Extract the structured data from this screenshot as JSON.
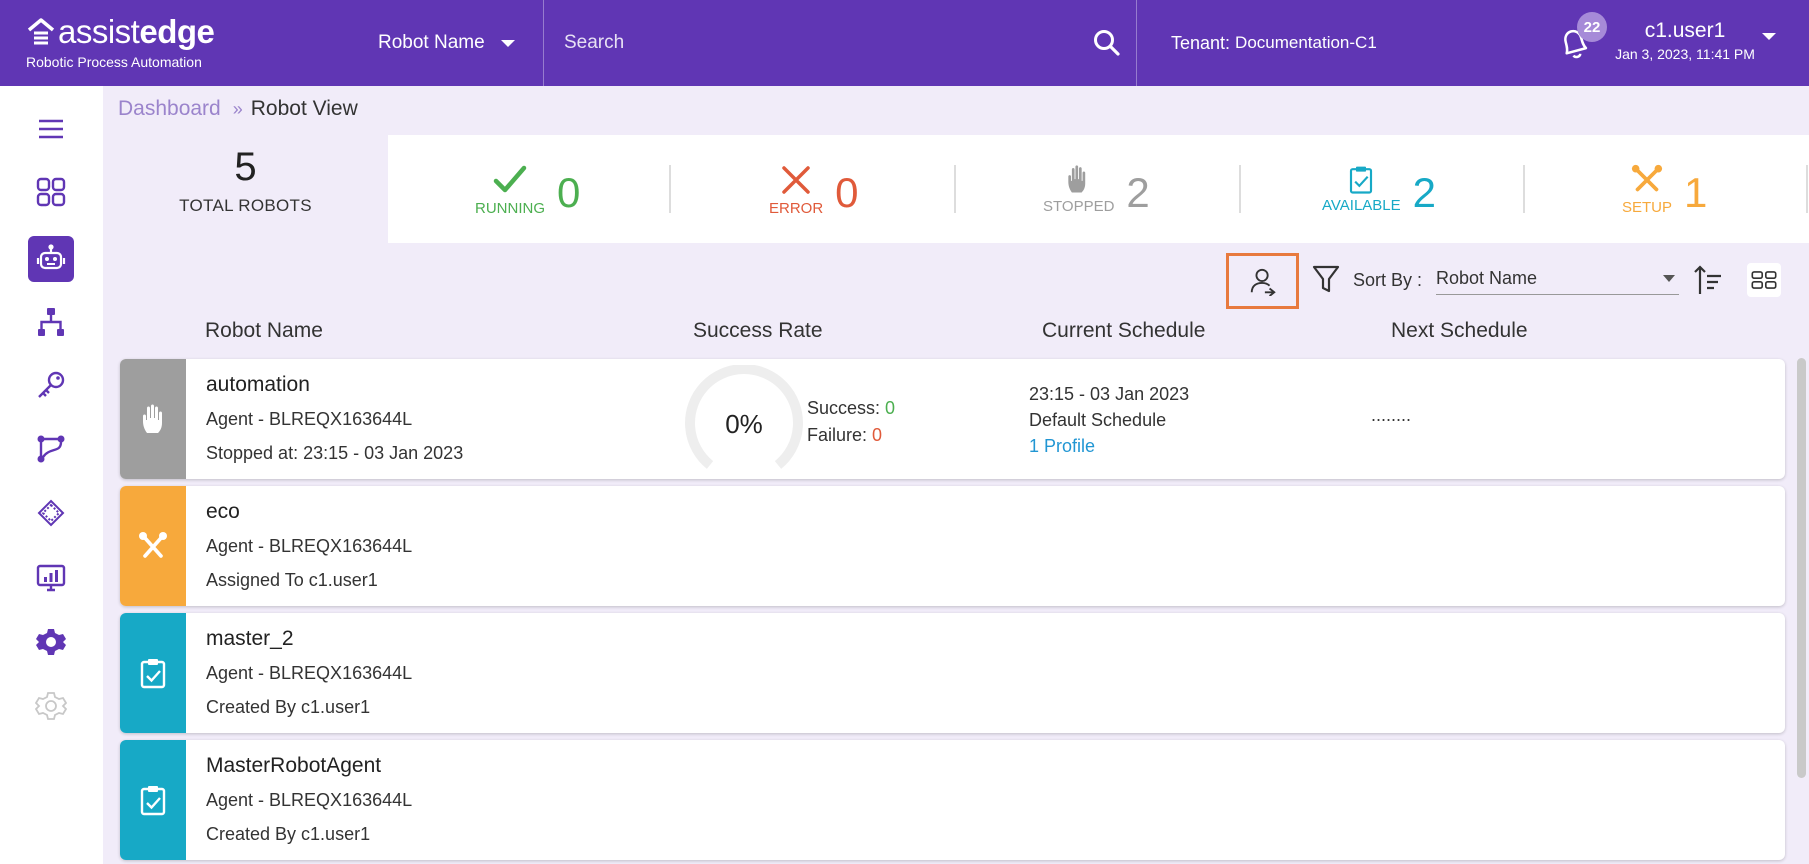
{
  "header": {
    "logo_light": "assist",
    "logo_bold": "edge",
    "logo_sub": "Robotic Process Automation",
    "robot_select_label": "Robot Name",
    "search_placeholder": "Search",
    "tenant_label": "Tenant:",
    "tenant_value": "Documentation-C1",
    "notification_count": "22",
    "user_name": "c1.user1",
    "user_datetime": "Jan 3, 2023, 11:41 PM"
  },
  "colors": {
    "brand": "#6036b4",
    "running": "#4caf50",
    "error": "#e05a3a",
    "stopped": "#9e9e9e",
    "available": "#17a9c6",
    "setup": "#f7a93c",
    "highlight": "#e87a3e"
  },
  "sidebar": {
    "items": [
      {
        "icon": "menu-icon"
      },
      {
        "icon": "dashboard-icon"
      },
      {
        "icon": "robot-icon",
        "active": true
      },
      {
        "icon": "hierarchy-icon"
      },
      {
        "icon": "key-icon"
      },
      {
        "icon": "workflow-icon"
      },
      {
        "icon": "chip-icon"
      },
      {
        "icon": "monitor-chart-icon"
      },
      {
        "icon": "settings-icon"
      },
      {
        "icon": "settings-disabled-icon"
      }
    ]
  },
  "breadcrumb": {
    "parent": "Dashboard",
    "separator": "»",
    "current": "Robot View"
  },
  "stats": {
    "total": {
      "value": "5",
      "label": "TOTAL ROBOTS"
    },
    "running": {
      "label": "RUNNING",
      "value": "0"
    },
    "error": {
      "label": "ERROR",
      "value": "0"
    },
    "stopped": {
      "label": "STOPPED",
      "value": "2"
    },
    "available": {
      "label": "AVAILABLE",
      "value": "2"
    },
    "setup": {
      "label": "SETUP",
      "value": "1"
    }
  },
  "toolbar": {
    "sort_by_label": "Sort By :",
    "sort_value": "Robot Name"
  },
  "columns": {
    "robot_name": "Robot Name",
    "success_rate": "Success Rate",
    "current_schedule": "Current Schedule",
    "next_schedule": "Next Schedule"
  },
  "robots": [
    {
      "name": "automation",
      "agent": "Agent - BLREQX163644L",
      "info": "Stopped at: 23:15 - 03 Jan 2023",
      "status": "stopped",
      "success_rate": "0%",
      "success_label": "Success:",
      "success_count": "0",
      "failure_label": "Failure:",
      "failure_count": "0",
      "schedule_time": "23:15 - 03 Jan 2023",
      "schedule_name": "Default Schedule",
      "schedule_profile": "1 Profile",
      "next_schedule": "........"
    },
    {
      "name": "eco",
      "agent": "Agent - BLREQX163644L",
      "info": "Assigned To c1.user1",
      "status": "setup"
    },
    {
      "name": "master_2",
      "agent": "Agent - BLREQX163644L",
      "info": "Created By c1.user1",
      "status": "available"
    },
    {
      "name": "MasterRobotAgent",
      "agent": "Agent - BLREQX163644L",
      "info": "Created By c1.user1",
      "status": "available"
    }
  ]
}
